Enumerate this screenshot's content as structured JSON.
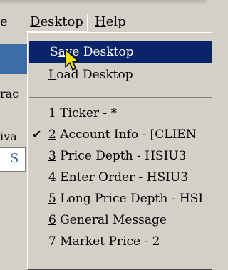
{
  "menubar": {
    "left_partial": "e",
    "desktop": "Desktop",
    "help": "Help"
  },
  "background": {
    "text_rac": "rac",
    "text_iva": "iva",
    "field_char": "S"
  },
  "menu": {
    "save_desktop": "Save Desktop",
    "load_desktop": "Load Desktop",
    "items": [
      "1 Ticker - *",
      "2 Account Info - [CLIEN",
      "3 Price Depth - HSIU3",
      "4 Enter Order - HSIU3",
      "5 Long Price Depth - HSI",
      "6 General Message",
      "7 Market Price - 2"
    ],
    "checked_index": 1,
    "check_glyph": "✔"
  },
  "colors": {
    "highlight": "#0a246a",
    "face": "#d4d0c8",
    "cursor": "#f2e200"
  },
  "icons": {
    "cursor": "arrow-cursor-icon"
  }
}
